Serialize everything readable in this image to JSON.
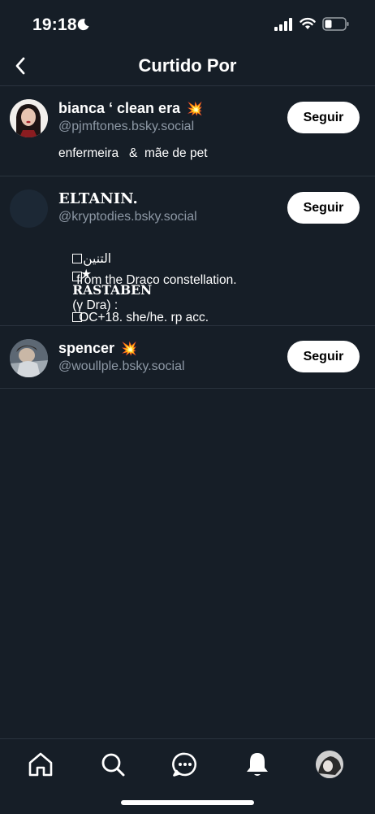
{
  "status_bar": {
    "time": "19:18"
  },
  "header": {
    "title": "Curtido Por"
  },
  "users": [
    {
      "display_name": "bianca ‘  clean era",
      "name_emoji": "💥",
      "handle": "@pjmftones.bsky.social",
      "bio": "enfermeira   &  mãe de pet",
      "follow_label": "Seguir"
    },
    {
      "display_name": "ELTANIN.",
      "handle": "@kryptodies.bsky.social",
      "bio_line1_arabic": "التنين",
      "bio_line1_star": "★",
      "bio_line1_name": "RASTABEN",
      "bio_line1_rest": "(γ Dra) :",
      "bio_line2": "from the Draco constellation.",
      "bio_line3": "OC+18. she/he. rp acc.",
      "follow_label": "Seguir"
    },
    {
      "display_name": "spencer",
      "name_emoji": "💥",
      "handle": "@woullple.bsky.social",
      "follow_label": "Seguir"
    }
  ],
  "tabs": [
    {
      "icon": "home-icon"
    },
    {
      "icon": "search-icon"
    },
    {
      "icon": "chat-icon"
    },
    {
      "icon": "bell-icon"
    },
    {
      "icon": "profile-avatar"
    }
  ],
  "colors": {
    "background": "#161e27",
    "divider": "#2a333e",
    "handle": "#8d98a5",
    "button": "#ffffff"
  }
}
